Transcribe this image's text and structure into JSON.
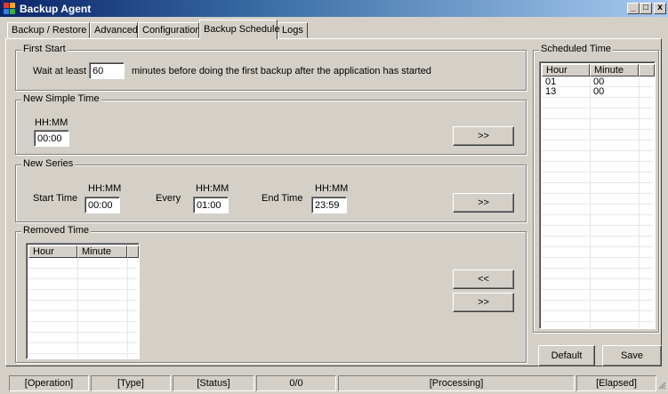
{
  "window": {
    "title": "Backup Agent",
    "minimize": "_",
    "maximize": "□",
    "close": "x"
  },
  "tabs": [
    {
      "label": "Backup / Restore"
    },
    {
      "label": "Advanced"
    },
    {
      "label": "Configuration"
    },
    {
      "label": "Backup Schedule"
    },
    {
      "label": "Logs"
    }
  ],
  "first_start": {
    "legend": "First Start",
    "prefix": "Wait at least",
    "minutes_value": "60",
    "suffix": "minutes before doing the first backup after the application has started"
  },
  "simple_time": {
    "legend": "New Simple Time",
    "hhmm_label": "HH:MM",
    "time_value": "00:00",
    "add_button": ">>"
  },
  "series": {
    "legend": "New Series",
    "start_label": "Start Time",
    "start_hhmm": "HH:MM",
    "start_value": "00:00",
    "every_label": "Every",
    "every_hhmm": "HH:MM",
    "every_value": "01:00",
    "end_label": "End Time",
    "end_hhmm": "HH:MM",
    "end_value": "23:59",
    "add_button": ">>"
  },
  "removed_time": {
    "legend": "Removed Time",
    "columns": [
      "Hour",
      "Minute"
    ],
    "rows": [],
    "restore_button": "<<",
    "remove_button": ">>"
  },
  "scheduled_time": {
    "legend": "Scheduled Time",
    "columns": [
      "Hour",
      "Minute"
    ],
    "rows": [
      {
        "hour": "01",
        "minute": "00"
      },
      {
        "hour": "13",
        "minute": "00"
      }
    ],
    "default_button": "Default",
    "save_button": "Save"
  },
  "status_bar": {
    "operation": "[Operation]",
    "type": "[Type]",
    "status": "[Status]",
    "count": "0/0",
    "processing": "[Processing]",
    "elapsed": "[Elapsed]"
  }
}
